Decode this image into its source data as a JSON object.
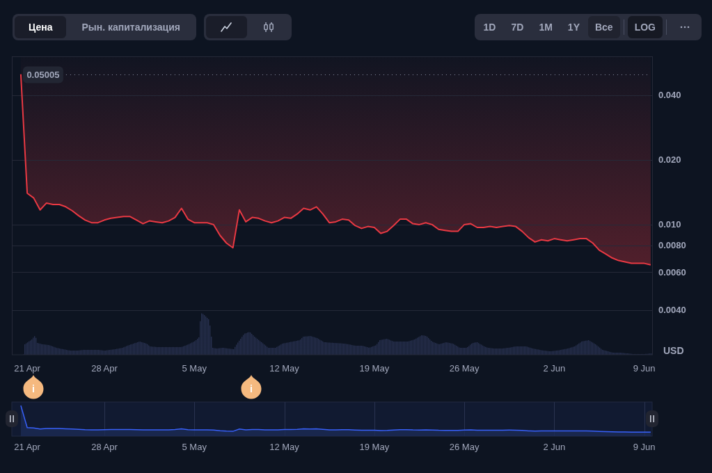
{
  "toolbar": {
    "view_tabs": [
      {
        "label": "Цена",
        "selected": true
      },
      {
        "label": "Рын. капитализация",
        "selected": false
      }
    ],
    "chart_types": [
      {
        "kind": "line",
        "selected": true
      },
      {
        "kind": "candles",
        "selected": false
      }
    ],
    "ranges": [
      {
        "label": "1D",
        "selected": false
      },
      {
        "label": "7D",
        "selected": false
      },
      {
        "label": "1M",
        "selected": false
      },
      {
        "label": "1Y",
        "selected": false
      },
      {
        "label": "Все",
        "selected": true
      }
    ],
    "log": {
      "label": "LOG",
      "on": true
    }
  },
  "chart": {
    "chart_data": {
      "type": "line",
      "log": true,
      "grid": true,
      "ylabel": "USD",
      "ylim": [
        0.00248,
        0.0602
      ],
      "categories": [
        null,
        "21 Apr",
        null,
        null,
        null,
        null,
        null,
        null,
        null,
        null,
        null,
        null,
        null,
        "28 Apr",
        null,
        null,
        null,
        null,
        null,
        null,
        null,
        null,
        null,
        null,
        null,
        null,
        null,
        "5 May",
        null,
        null,
        null,
        null,
        null,
        null,
        null,
        null,
        null,
        null,
        null,
        null,
        null,
        "12 May",
        null,
        null,
        null,
        null,
        null,
        null,
        null,
        null,
        null,
        null,
        null,
        null,
        null,
        "19 May",
        null,
        null,
        null,
        null,
        null,
        null,
        null,
        null,
        null,
        null,
        null,
        null,
        null,
        "26 May",
        null,
        null,
        null,
        null,
        null,
        null,
        null,
        null,
        null,
        null,
        null,
        null,
        null,
        "2 Jun",
        null,
        null,
        null,
        null,
        null,
        null,
        null,
        null,
        null,
        null,
        null,
        null,
        null,
        "9 Jun",
        null
      ],
      "yticks": [
        {
          "value": 0.004,
          "label": "0.0040"
        },
        {
          "value": 0.006,
          "label": "0.0060"
        },
        {
          "value": 0.008,
          "label": "0.0080"
        },
        {
          "value": 0.01,
          "label": "0.010"
        },
        {
          "value": 0.02,
          "label": "0.020"
        },
        {
          "value": 0.04,
          "label": "0.040"
        }
      ],
      "values": [
        0.05005,
        0.014,
        0.0133,
        0.0117,
        0.0126,
        0.0124,
        0.0124,
        0.0121,
        0.0116,
        0.011,
        0.0105,
        0.0102,
        0.0102,
        0.0105,
        0.0107,
        0.0108,
        0.0109,
        0.0109,
        0.0105,
        0.0101,
        0.0104,
        0.0103,
        0.0102,
        0.0104,
        0.0108,
        0.0119,
        0.0106,
        0.0102,
        0.0102,
        0.0102,
        0.01,
        0.0089,
        0.0082,
        0.0078,
        0.0117,
        0.0103,
        0.0108,
        0.0107,
        0.0104,
        0.0102,
        0.0104,
        0.0108,
        0.0107,
        0.0112,
        0.0119,
        0.0117,
        0.0121,
        0.0112,
        0.0102,
        0.0103,
        0.0106,
        0.0105,
        0.0099,
        0.0096,
        0.0098,
        0.0097,
        0.0091,
        0.0093,
        0.0099,
        0.0106,
        0.0106,
        0.0101,
        0.01,
        0.0102,
        0.01,
        0.0095,
        0.0094,
        0.0093,
        0.0093,
        0.01,
        0.0101,
        0.0097,
        0.0097,
        0.0098,
        0.0097,
        0.0098,
        0.0099,
        0.0098,
        0.0093,
        0.0087,
        0.0083,
        0.0085,
        0.0084,
        0.0086,
        0.0085,
        0.0084,
        0.0085,
        0.0086,
        0.0086,
        0.0082,
        0.0076,
        0.0073,
        0.007,
        0.0068,
        0.0067,
        0.0066,
        0.0066,
        0.0066,
        0.0065
      ],
      "ref_lines": [
        {
          "axis": "y",
          "value": 0.05005,
          "label": "0.05005"
        }
      ]
    }
  },
  "events": [
    {
      "label": "i"
    },
    {
      "label": "i"
    }
  ],
  "navigator": {
    "labels": [
      "21 Apr",
      "28 Apr",
      "5 May",
      "12 May",
      "19 May",
      "26 May",
      "2 Jun",
      "9 Jun"
    ]
  }
}
